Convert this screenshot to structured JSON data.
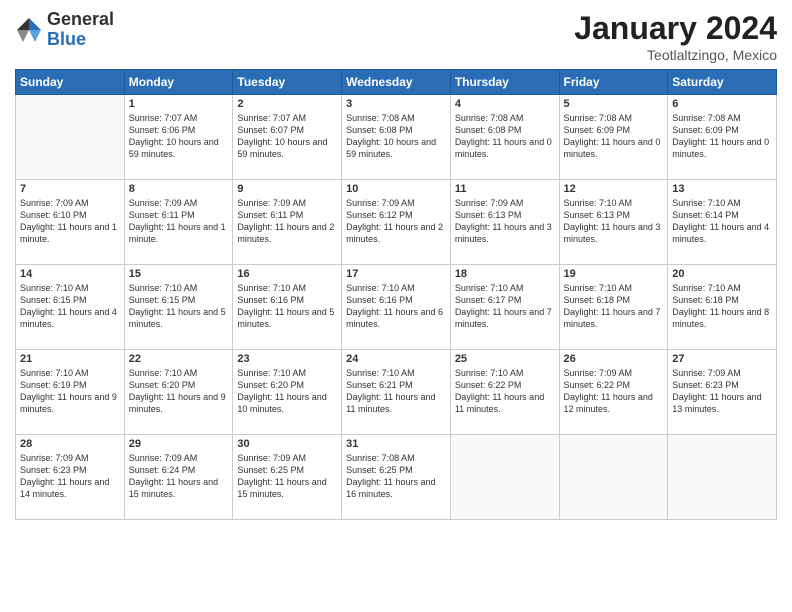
{
  "logo": {
    "general": "General",
    "blue": "Blue"
  },
  "title": {
    "month_year": "January 2024",
    "location": "Teotlaltzingo, Mexico"
  },
  "headers": [
    "Sunday",
    "Monday",
    "Tuesday",
    "Wednesday",
    "Thursday",
    "Friday",
    "Saturday"
  ],
  "weeks": [
    [
      {
        "day": "",
        "info": ""
      },
      {
        "day": "1",
        "info": "Sunrise: 7:07 AM\nSunset: 6:06 PM\nDaylight: 10 hours\nand 59 minutes."
      },
      {
        "day": "2",
        "info": "Sunrise: 7:07 AM\nSunset: 6:07 PM\nDaylight: 10 hours\nand 59 minutes."
      },
      {
        "day": "3",
        "info": "Sunrise: 7:08 AM\nSunset: 6:08 PM\nDaylight: 10 hours\nand 59 minutes."
      },
      {
        "day": "4",
        "info": "Sunrise: 7:08 AM\nSunset: 6:08 PM\nDaylight: 11 hours\nand 0 minutes."
      },
      {
        "day": "5",
        "info": "Sunrise: 7:08 AM\nSunset: 6:09 PM\nDaylight: 11 hours\nand 0 minutes."
      },
      {
        "day": "6",
        "info": "Sunrise: 7:08 AM\nSunset: 6:09 PM\nDaylight: 11 hours\nand 0 minutes."
      }
    ],
    [
      {
        "day": "7",
        "info": "Sunrise: 7:09 AM\nSunset: 6:10 PM\nDaylight: 11 hours\nand 1 minute."
      },
      {
        "day": "8",
        "info": "Sunrise: 7:09 AM\nSunset: 6:11 PM\nDaylight: 11 hours\nand 1 minute."
      },
      {
        "day": "9",
        "info": "Sunrise: 7:09 AM\nSunset: 6:11 PM\nDaylight: 11 hours\nand 2 minutes."
      },
      {
        "day": "10",
        "info": "Sunrise: 7:09 AM\nSunset: 6:12 PM\nDaylight: 11 hours\nand 2 minutes."
      },
      {
        "day": "11",
        "info": "Sunrise: 7:09 AM\nSunset: 6:13 PM\nDaylight: 11 hours\nand 3 minutes."
      },
      {
        "day": "12",
        "info": "Sunrise: 7:10 AM\nSunset: 6:13 PM\nDaylight: 11 hours\nand 3 minutes."
      },
      {
        "day": "13",
        "info": "Sunrise: 7:10 AM\nSunset: 6:14 PM\nDaylight: 11 hours\nand 4 minutes."
      }
    ],
    [
      {
        "day": "14",
        "info": "Sunrise: 7:10 AM\nSunset: 6:15 PM\nDaylight: 11 hours\nand 4 minutes."
      },
      {
        "day": "15",
        "info": "Sunrise: 7:10 AM\nSunset: 6:15 PM\nDaylight: 11 hours\nand 5 minutes."
      },
      {
        "day": "16",
        "info": "Sunrise: 7:10 AM\nSunset: 6:16 PM\nDaylight: 11 hours\nand 5 minutes."
      },
      {
        "day": "17",
        "info": "Sunrise: 7:10 AM\nSunset: 6:16 PM\nDaylight: 11 hours\nand 6 minutes."
      },
      {
        "day": "18",
        "info": "Sunrise: 7:10 AM\nSunset: 6:17 PM\nDaylight: 11 hours\nand 7 minutes."
      },
      {
        "day": "19",
        "info": "Sunrise: 7:10 AM\nSunset: 6:18 PM\nDaylight: 11 hours\nand 7 minutes."
      },
      {
        "day": "20",
        "info": "Sunrise: 7:10 AM\nSunset: 6:18 PM\nDaylight: 11 hours\nand 8 minutes."
      }
    ],
    [
      {
        "day": "21",
        "info": "Sunrise: 7:10 AM\nSunset: 6:19 PM\nDaylight: 11 hours\nand 9 minutes."
      },
      {
        "day": "22",
        "info": "Sunrise: 7:10 AM\nSunset: 6:20 PM\nDaylight: 11 hours\nand 9 minutes."
      },
      {
        "day": "23",
        "info": "Sunrise: 7:10 AM\nSunset: 6:20 PM\nDaylight: 11 hours\nand 10 minutes."
      },
      {
        "day": "24",
        "info": "Sunrise: 7:10 AM\nSunset: 6:21 PM\nDaylight: 11 hours\nand 11 minutes."
      },
      {
        "day": "25",
        "info": "Sunrise: 7:10 AM\nSunset: 6:22 PM\nDaylight: 11 hours\nand 11 minutes."
      },
      {
        "day": "26",
        "info": "Sunrise: 7:09 AM\nSunset: 6:22 PM\nDaylight: 11 hours\nand 12 minutes."
      },
      {
        "day": "27",
        "info": "Sunrise: 7:09 AM\nSunset: 6:23 PM\nDaylight: 11 hours\nand 13 minutes."
      }
    ],
    [
      {
        "day": "28",
        "info": "Sunrise: 7:09 AM\nSunset: 6:23 PM\nDaylight: 11 hours\nand 14 minutes."
      },
      {
        "day": "29",
        "info": "Sunrise: 7:09 AM\nSunset: 6:24 PM\nDaylight: 11 hours\nand 15 minutes."
      },
      {
        "day": "30",
        "info": "Sunrise: 7:09 AM\nSunset: 6:25 PM\nDaylight: 11 hours\nand 15 minutes."
      },
      {
        "day": "31",
        "info": "Sunrise: 7:08 AM\nSunset: 6:25 PM\nDaylight: 11 hours\nand 16 minutes."
      },
      {
        "day": "",
        "info": ""
      },
      {
        "day": "",
        "info": ""
      },
      {
        "day": "",
        "info": ""
      }
    ]
  ]
}
